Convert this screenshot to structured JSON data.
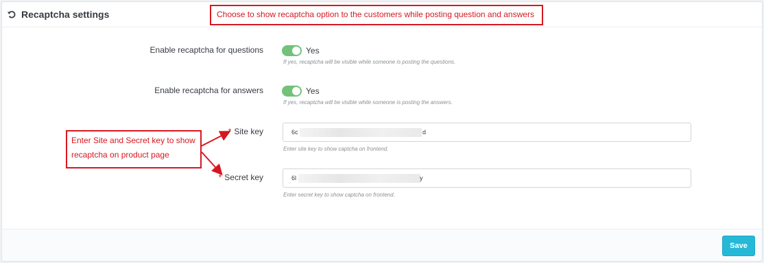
{
  "header": {
    "title": "Recaptcha settings",
    "icon": "undo-icon"
  },
  "settings": {
    "questions": {
      "label": "Enable recaptcha for questions",
      "toggle_value": "Yes",
      "help": "If yes, recaptcha will be visible while someone is posting the questions."
    },
    "answers": {
      "label": "Enable recaptcha for answers",
      "toggle_value": "Yes",
      "help": "If yes, recaptcha will be visible while someone is posting the answers."
    },
    "site_key": {
      "required_mark": "*",
      "label": "Site key",
      "value_start": "6c",
      "value_end": "d",
      "help": "Enter site key to show captcha on frontend."
    },
    "secret_key": {
      "required_mark": "*",
      "label": "Secret key",
      "value_start": "6l",
      "value_end": "y",
      "help": "Enter secret key to show captcha on frontend."
    }
  },
  "footer": {
    "save_label": "Save"
  },
  "annotations": {
    "top": "Choose to show recaptcha option to the customers while posting question and answers",
    "left_line1": "Enter Site and Secret key to show",
    "left_line2": "recaptcha on product page"
  },
  "colors": {
    "accent": "#25b9d7",
    "switch_on": "#72c279",
    "annotation": "#d7171f"
  }
}
